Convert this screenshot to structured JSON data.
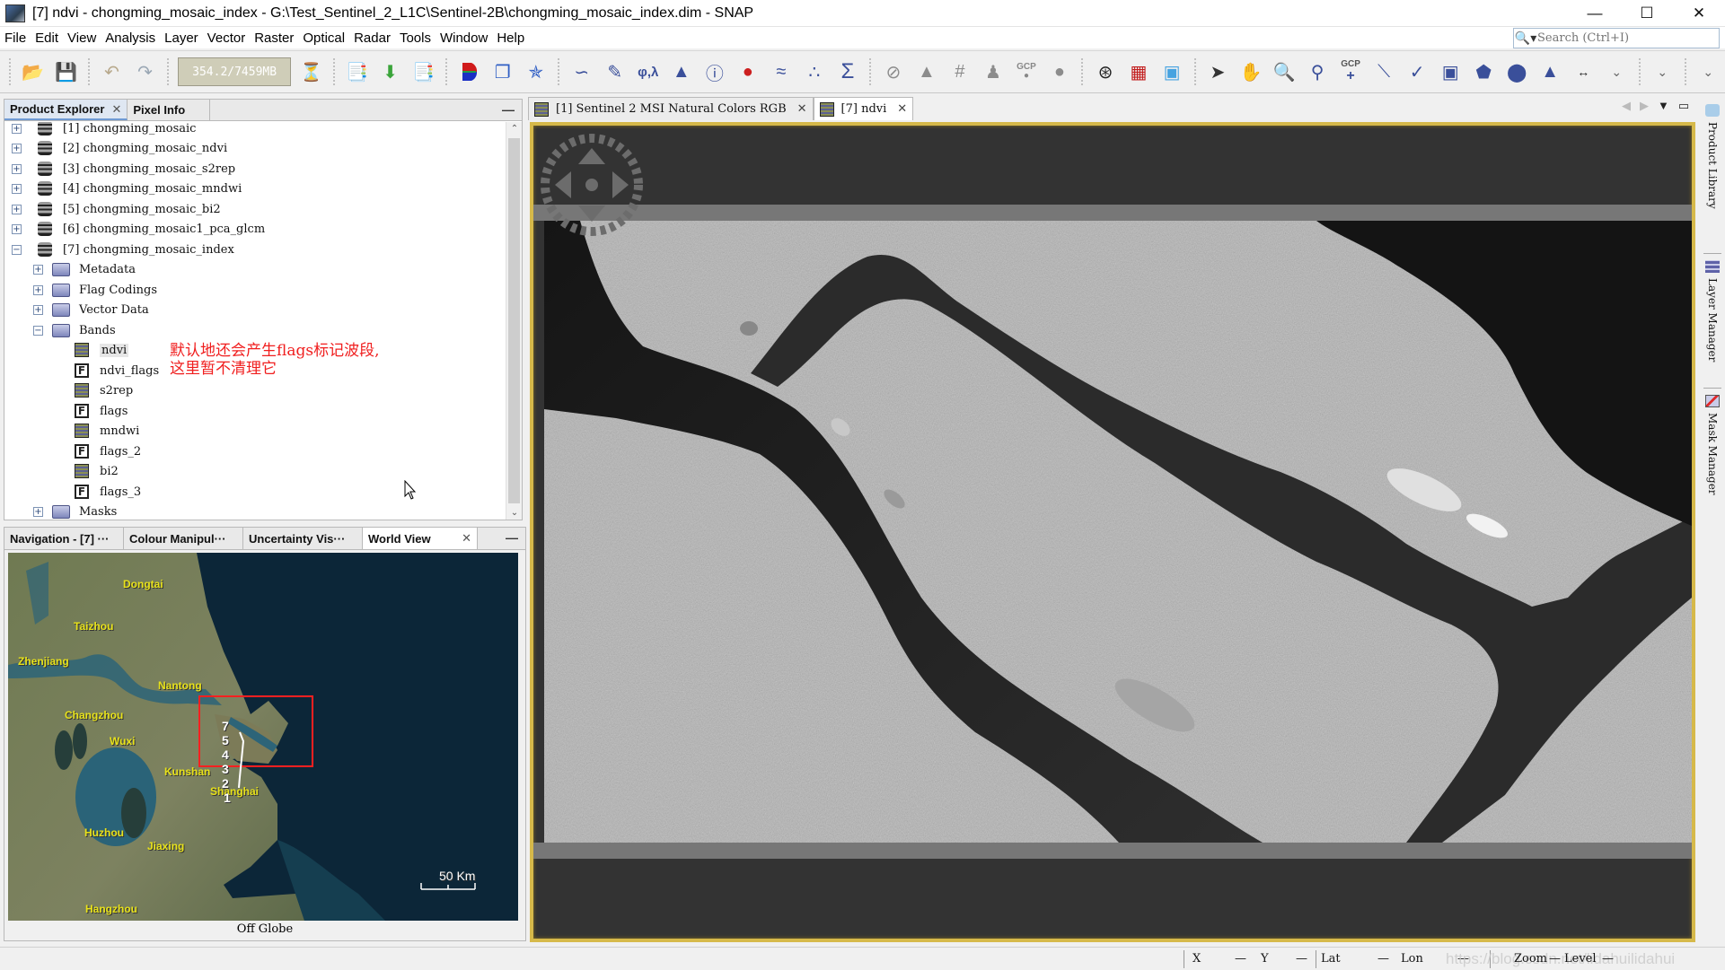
{
  "window": {
    "title": "[7] ndvi - chongming_mosaic_index - G:\\Test_Sentinel_2_L1C\\Sentinel-2B\\chongming_mosaic_index.dim - SNAP",
    "controls": [
      "minimize",
      "maximize",
      "close"
    ]
  },
  "menu": {
    "items": [
      "File",
      "Edit",
      "View",
      "Analysis",
      "Layer",
      "Vector",
      "Raster",
      "Optical",
      "Radar",
      "Tools",
      "Window",
      "Help"
    ],
    "search_placeholder": "Search (Ctrl+I)"
  },
  "toolbar": {
    "memory": "354.2/7459MB",
    "gcp_label": "GCP",
    "icons": [
      "open-product-icon",
      "save-product-icon",
      "undo-icon",
      "redo-icon",
      "memory-gauge",
      "gc-clock-icon",
      "product-library-icon",
      "import-icon",
      "export-icon",
      "rgb-image-icon",
      "tiled-windows-icon",
      "wave-icon",
      "spectrum-view-icon",
      "edit-vector-icon",
      "geo-coding-icon",
      "histogram-icon",
      "information-icon",
      "statistics-icon",
      "profile-plot-icon",
      "scatter-plot-icon",
      "band-maths-icon",
      "pin-manager-icon",
      "gcp-manager-icon",
      "graticule-icon",
      "mask-icon",
      "gcp-icon",
      "world-map-icon",
      "graph-builder-icon",
      "batch-processing-icon",
      "world-view-icon",
      "select-tool-icon",
      "pan-tool-icon",
      "zoom-tool-icon",
      "pin-placing-icon",
      "gcp-placing-icon",
      "line-drawing-icon",
      "polyline-drawing-icon",
      "rectangle-drawing-icon",
      "polygon-drawing-icon",
      "ellipse-drawing-icon",
      "insert-figure-icon",
      "range-finder-icon",
      "more-icon"
    ]
  },
  "product_explorer": {
    "tabs": [
      {
        "label": "Product Explorer",
        "active": true,
        "closable": true
      },
      {
        "label": "Pixel Info",
        "active": false,
        "closable": false
      }
    ],
    "products": [
      {
        "id": "[1]",
        "name": "chongming_mosaic",
        "expanded": false
      },
      {
        "id": "[2]",
        "name": "chongming_mosaic_ndvi",
        "expanded": false
      },
      {
        "id": "[3]",
        "name": "chongming_mosaic_s2rep",
        "expanded": false
      },
      {
        "id": "[4]",
        "name": "chongming_mosaic_mndwi",
        "expanded": false
      },
      {
        "id": "[5]",
        "name": "chongming_mosaic_bi2",
        "expanded": false
      },
      {
        "id": "[6]",
        "name": "chongming_mosaic1_pca_glcm",
        "expanded": false
      },
      {
        "id": "[7]",
        "name": "chongming_mosaic_index",
        "expanded": true
      }
    ],
    "groups": [
      {
        "name": "Metadata",
        "expanded": false
      },
      {
        "name": "Flag Codings",
        "expanded": false
      },
      {
        "name": "Vector Data",
        "expanded": false
      },
      {
        "name": "Bands",
        "expanded": true
      },
      {
        "name": "Masks",
        "expanded": false
      }
    ],
    "bands": [
      {
        "name": "ndvi",
        "type": "band",
        "selected": true
      },
      {
        "name": "ndvi_flags",
        "type": "flag"
      },
      {
        "name": "s2rep",
        "type": "band"
      },
      {
        "name": "flags",
        "type": "flag"
      },
      {
        "name": "mndwi",
        "type": "band"
      },
      {
        "name": "flags_2",
        "type": "flag"
      },
      {
        "name": "bi2",
        "type": "band"
      },
      {
        "name": "flags_3",
        "type": "flag"
      }
    ],
    "annotation": {
      "line1": "默认地还会产生flags标记波段,",
      "line2": "这里暂不清理它",
      "color": "#f01e1e"
    }
  },
  "bottom_panel": {
    "tabs": [
      {
        "label": "Navigation - [7] ···",
        "active": false
      },
      {
        "label": "Colour Manipul···",
        "active": false
      },
      {
        "label": "Uncertainty Vis···",
        "active": false
      },
      {
        "label": "World View",
        "active": true,
        "closable": true
      }
    ],
    "world_view": {
      "cities": [
        "Dongtai",
        "Taizhou",
        "Zhenjiang",
        "Nantong",
        "Changzhou",
        "Wuxi",
        "Kunshan",
        "Shanghai",
        "Huzhou",
        "Jiaxing",
        "Hangzhou"
      ],
      "product_numbers": [
        "7",
        "5",
        "4",
        "3",
        "2",
        "1"
      ],
      "scale_label": "50 Km",
      "status": "Off Globe",
      "highlight_color": "#ff2020"
    }
  },
  "document": {
    "tabs": [
      {
        "label": "[1] Sentinel 2 MSI Natural Colors RGB",
        "active": false
      },
      {
        "label": "[7] ndvi",
        "active": true
      }
    ],
    "active_border_color": "#d6b94a"
  },
  "right_sidebar": {
    "tabs": [
      "Product Library",
      "Layer Manager",
      "Mask Manager"
    ]
  },
  "statusbar": {
    "x_label": "X",
    "x_value": "—",
    "y_label": "Y",
    "y_value": "—",
    "lat_label": "Lat",
    "lat_value": "—",
    "lon_label": "Lon",
    "lon_value": "—",
    "zoom_label": "Zoom",
    "zoom_value": "—",
    "level_label": "Level",
    "level_value": "—",
    "watermark": "https://blog.csdn.net/lidahuilidahui"
  }
}
